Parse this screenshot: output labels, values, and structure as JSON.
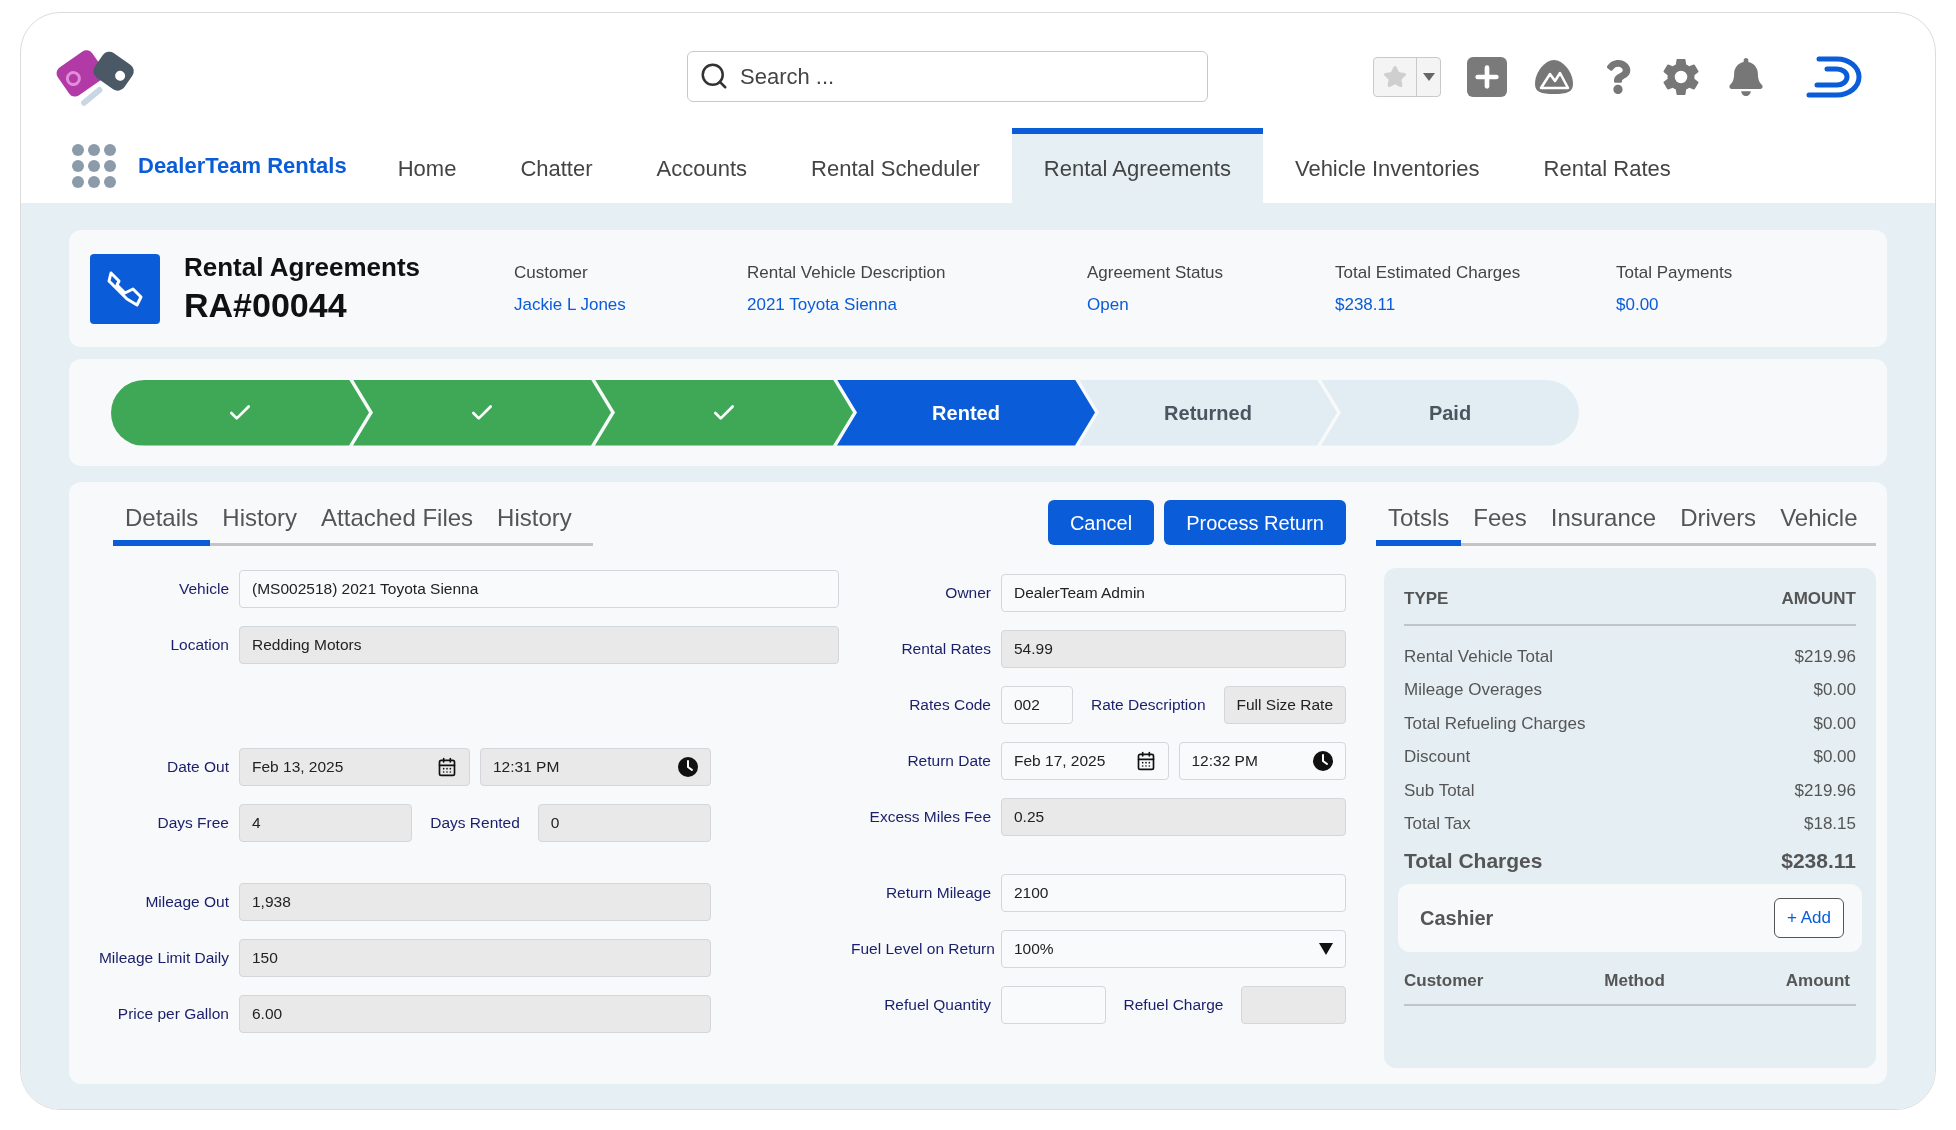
{
  "header": {
    "search": {
      "placeholder": "Search ..."
    }
  },
  "nav": {
    "app_name": "DealerTeam Rentals",
    "tabs": [
      {
        "label": "Home",
        "selected": false
      },
      {
        "label": "Chatter",
        "selected": false
      },
      {
        "label": "Accounts",
        "selected": false
      },
      {
        "label": "Rental Scheduler",
        "selected": false
      },
      {
        "label": "Rental Agreements",
        "selected": true
      },
      {
        "label": "Vehicle Inventories",
        "selected": false
      },
      {
        "label": "Rental Rates",
        "selected": false
      }
    ]
  },
  "record": {
    "object": "Rental Agreements",
    "name": "RA#00044",
    "fields": [
      {
        "label": "Customer",
        "value": "Jackie L Jones"
      },
      {
        "label": "Rental Vehicle Description",
        "value": "2021 Toyota Sienna"
      },
      {
        "label": "Agreement Status",
        "value": "Open"
      },
      {
        "label": "Total Estimated Charges",
        "value": "$238.11"
      },
      {
        "label": "Total Payments",
        "value": "$0.00"
      }
    ]
  },
  "path": {
    "steps": [
      {
        "kind": "complete"
      },
      {
        "kind": "complete"
      },
      {
        "kind": "complete"
      },
      {
        "label": "Rented",
        "kind": "current"
      },
      {
        "label": "Returned",
        "kind": "upcoming"
      },
      {
        "label": "Paid",
        "kind": "upcoming"
      }
    ]
  },
  "detail_tabs": [
    {
      "label": "Details",
      "selected": true
    },
    {
      "label": "History",
      "selected": false
    },
    {
      "label": "Attached Files",
      "selected": false
    },
    {
      "label": "History",
      "selected": false
    }
  ],
  "actions": [
    "Cancel",
    "Process Return"
  ],
  "form": {
    "left": [
      [
        {
          "fields": [
            {
              "label": "Vehicle",
              "value": "(MS002518) 2021 Toyota Sienna",
              "kind": "text",
              "editable": true
            }
          ]
        },
        {
          "fields": [
            {
              "label": "Location",
              "value": "Redding Motors",
              "kind": "text",
              "editable": false
            }
          ]
        }
      ],
      [
        {
          "fields": [
            {
              "label": "Date Out",
              "value": "Feb 13, 2025",
              "kind": "date",
              "editable": false
            },
            {
              "value": "12:31 PM",
              "kind": "time",
              "editable": false
            }
          ]
        },
        {
          "fields": [
            {
              "label": "Days Free",
              "value": "4",
              "kind": "text",
              "editable": false
            },
            {
              "label": "Days Rented",
              "value": "0",
              "kind": "text",
              "editable": false
            }
          ]
        }
      ],
      [
        {
          "fields": [
            {
              "label": "Mileage Out",
              "value": "1,938",
              "kind": "text",
              "editable": false
            }
          ]
        },
        {
          "fields": [
            {
              "label": "Mileage Limit Daily",
              "value": "150",
              "kind": "text",
              "editable": false
            }
          ]
        },
        {
          "fields": [
            {
              "label": "Price per Gallon",
              "value": "6.00",
              "kind": "text",
              "editable": false
            }
          ]
        }
      ]
    ],
    "right": [
      [
        {
          "fields": [
            {
              "label": "Owner",
              "value": "DealerTeam Admin",
              "kind": "text",
              "editable": true
            }
          ]
        },
        {
          "fields": [
            {
              "label": "Rental Rates",
              "value": "54.99",
              "kind": "text",
              "editable": false
            }
          ]
        },
        {
          "fields": [
            {
              "label": "Rates Code",
              "value": "002",
              "kind": "text",
              "editable": true
            },
            {
              "label": "Rate Description",
              "value": "Full Size Rate",
              "kind": "text",
              "editable": false
            }
          ]
        },
        {
          "fields": [
            {
              "label": "Return Date",
              "value": "Feb 17, 2025",
              "kind": "date",
              "editable": true
            },
            {
              "value": "12:32 PM",
              "kind": "time",
              "editable": true
            }
          ]
        },
        {
          "fields": [
            {
              "label": "Excess Miles Fee",
              "value": "0.25",
              "kind": "text",
              "editable": false
            }
          ]
        }
      ],
      [
        {
          "fields": [
            {
              "label": "Return Mileage",
              "value": "2100",
              "kind": "text",
              "editable": true
            }
          ]
        },
        {
          "fields": [
            {
              "label": "Fuel Level on Return",
              "value": "100%",
              "kind": "select",
              "editable": true
            }
          ]
        },
        {
          "fields": [
            {
              "label": "Refuel Quantity",
              "kind": "text",
              "editable": true
            },
            {
              "label": "Refuel Charge",
              "kind": "text",
              "editable": false
            }
          ]
        }
      ]
    ]
  },
  "side_tabs": [
    {
      "label": "Totsls",
      "selected": true
    },
    {
      "label": "Fees",
      "selected": false
    },
    {
      "label": "Insurance",
      "selected": false
    },
    {
      "label": "Drivers",
      "selected": false
    },
    {
      "label": "Vehicle",
      "selected": false
    }
  ],
  "totals": {
    "columns": [
      "TYPE",
      "AMOUNT"
    ],
    "rows": [
      {
        "type": "Rental Vehicle Total",
        "amount": "$219.96",
        "kind": "line"
      },
      {
        "type": "Mileage Overages",
        "amount": "$0.00",
        "kind": "line"
      },
      {
        "type": "Total Refueling Charges",
        "amount": "$0.00",
        "kind": "line"
      },
      {
        "type": "Discount",
        "amount": "$0.00",
        "kind": "line"
      },
      {
        "type": "Sub Total",
        "amount": "$219.96",
        "kind": "line"
      },
      {
        "type": "Total Tax",
        "amount": "$18.15",
        "kind": "line"
      },
      {
        "type": "Total Charges",
        "amount": "$238.11",
        "kind": "total"
      }
    ]
  },
  "cashier": {
    "title": "Cashier",
    "add_button": "+ Add",
    "columns": [
      "Customer",
      "Method",
      "Amount"
    ]
  }
}
